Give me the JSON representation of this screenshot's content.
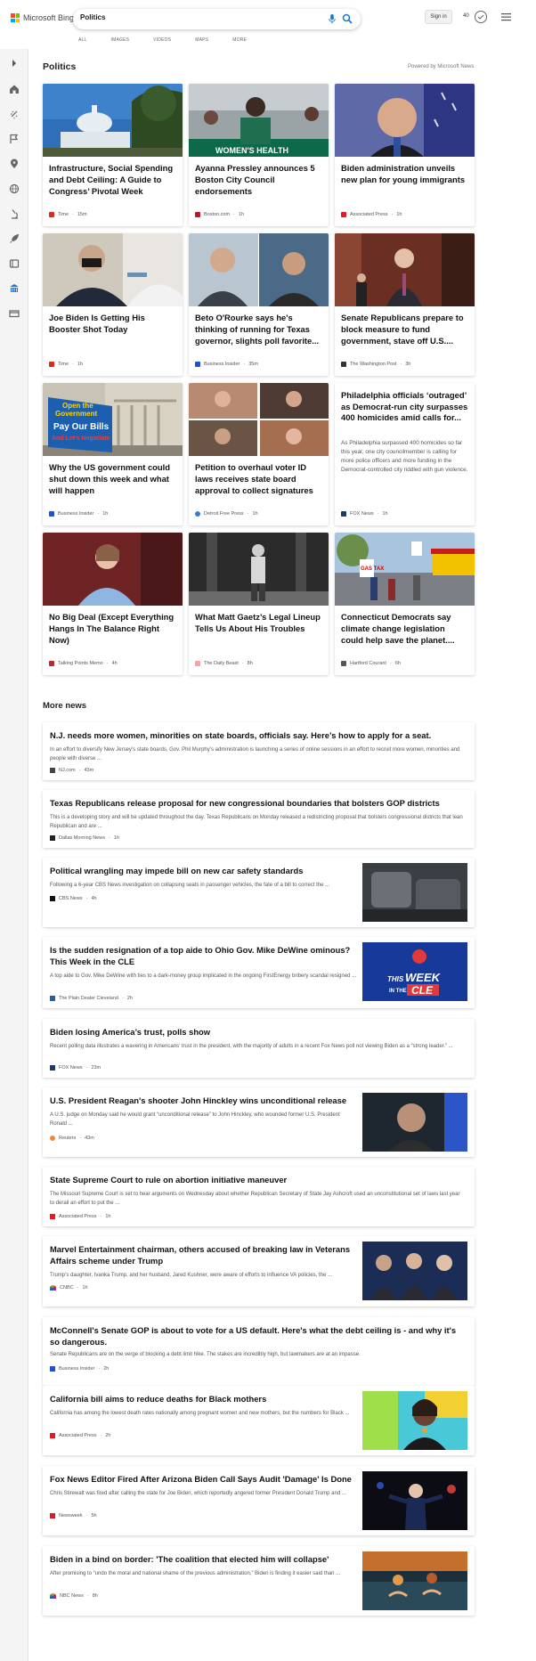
{
  "header": {
    "brand": "Microsoft Bing",
    "search_value": "Politics",
    "signin_label": "Sign in",
    "rewards_count": "40",
    "tabs": [
      "ALL",
      "IMAGES",
      "VIDEOS",
      "MAPS",
      "MORE"
    ]
  },
  "section": {
    "title": "Politics",
    "powered_by": "Powered by Microsoft News"
  },
  "cards": [
    {
      "title": "Infrastructure, Social Spending and Debt Ceiling: A Guide to Congress’ Pivotal Week",
      "source": "Time",
      "time": "15m",
      "fav": "#d82c20"
    },
    {
      "title": "Ayanna Pressley announces 5 Boston City Council endorsements",
      "source": "Boston.com",
      "time": "1h",
      "fav": "#c8102e",
      "image_caption": "WOMEN'S HEALTH"
    },
    {
      "title": "Biden administration unveils new plan for young immigrants",
      "source": "Associated Press",
      "time": "1h",
      "fav": "#e31b23"
    },
    {
      "title": "Joe Biden Is Getting His Booster Shot Today",
      "source": "Time",
      "time": "1h",
      "fav": "#d82c20"
    },
    {
      "title": "Beto O'Rourke says he's thinking of running for Texas governor, slights poll favorite...",
      "source": "Business Insider",
      "time": "35m",
      "fav": "#1a53d8"
    },
    {
      "title": "Senate Republicans prepare to block measure to fund government, stave off U.S....",
      "source": "The Washington Post",
      "time": "3h",
      "fav": "#333333"
    },
    {
      "title": "Why the US government could shut down this week and what will happen",
      "source": "Business Insider",
      "time": "1h",
      "fav": "#1a53d8",
      "sign_lines": [
        "Open the",
        "Government",
        "Pay Our Bills",
        "And Let's Negotiate"
      ]
    },
    {
      "title": "Petition to overhaul voter ID laws receives state board approval to collect signatures",
      "source": "Detroit Free Press",
      "time": "1h",
      "fav": "#3a7bd5"
    },
    {
      "title": "Philadelphia officials ‘outraged’ as Democrat-run city surpasses 400 homicides amid calls for...",
      "description": "As Philadelphia surpassed 400 homicides so far this year, one city councilmember is calling for more police officers and more funding in the Democrat-controlled city riddled with gun violence.",
      "source": "FOX News",
      "time": "1h",
      "fav": "#1b3a6b"
    },
    {
      "title": "No Big Deal (Except Everything Hangs In The Balance Right Now)",
      "source": "Talking Points Memo",
      "time": "4h",
      "fav": "#c0262d"
    },
    {
      "title": "What Matt Gaetz’s Legal Lineup Tells Us About His Troubles",
      "source": "The Daily Beast",
      "time": "8h",
      "fav": "#f5a3a3"
    },
    {
      "title": "Connecticut Democrats say climate change legislation could help save the planet....",
      "source": "Hartford Courant",
      "time": "6h",
      "fav": "#555555",
      "sign_text": "GAS TAX"
    }
  ],
  "more_news": {
    "title": "More news",
    "items": [
      {
        "title": "N.J. needs more women, minorities on state boards, officials say. Here’s how to apply for a seat.",
        "description": "In an effort to diversify New Jersey’s state boards, Gov. Phil Murphy’s administration is launching a series of online sessions in an effort to recruit more women, minorities and people with diverse ...",
        "source": "NJ.com",
        "time": "43m",
        "fav": "#444444"
      },
      {
        "title": "Texas Republicans release proposal for new congressional boundaries that bolsters GOP districts",
        "description": "This is a developing story and will be updated throughout the day. Texas Republicans on Monday released a redistricting proposal that bolsters congressional districts that lean Republican and are ...",
        "source": "Dallas Morning News",
        "time": "1h",
        "fav": "#222222"
      },
      {
        "title": "Political wrangling may impede bill on new car safety standards",
        "description": "Following a 6-year CBS News investigation on collapsing seats in passenger vehicles, the fate of a bill to correct the ...",
        "source": "CBS News",
        "time": "4h",
        "fav": "#111111"
      },
      {
        "title": "Is the sudden resignation of a top aide to Ohio Gov. Mike DeWine ominous? This Week in the CLE",
        "description": "A top aide to Gov. Mike DeWine with ties to a dark-money group implicated in the ongoing FirstEnergy bribery scandal resigned ...",
        "source": "The Plain Dealer Cleveland",
        "time": "2h",
        "fav": "#2b5c9c",
        "image_text": [
          "THIS",
          "WEEK",
          "IN THE",
          "CLE"
        ]
      },
      {
        "title": "Biden losing America’s trust, polls show",
        "description": "Recent polling data illustrates a wavering in Americans’ trust in the president, with the majority of adults in a recent Fox News poll not viewing Biden as a “strong leader.” ...",
        "source": "FOX News",
        "time": "23m",
        "fav": "#1b3a6b"
      },
      {
        "title": "U.S. President Reagan's shooter John Hinckley wins unconditional release",
        "description": "A U.S. judge on Monday said he would grant “unconditional release” to John Hinckley, who wounded former U.S. President Ronald ...",
        "source": "Reuters",
        "time": "43m",
        "fav": "#f28b30"
      },
      {
        "title": "State Supreme Court to rule on abortion initiative maneuver",
        "description": "The Missouri Supreme Court is set to hear arguments on Wednesday about whether Republican Secretary of State Jay Ashcroft used an unconstitutional set of laws last year to derail an effort to put the ...",
        "source": "Associated Press",
        "time": "1h",
        "fav": "#e31b23"
      },
      {
        "title": "Marvel Entertainment chairman, others accused of breaking law in Veterans Affairs scheme under Trump",
        "description": "Trump’s daughter, Ivanka Trump, and her husband, Jared Kushner, were aware of efforts to influence VA policies, the ...",
        "source": "CNBC",
        "time": "1h",
        "fav": "#e6a11b"
      },
      {
        "title": "McConnell's Senate GOP is about to vote for a US default. Here's what the debt ceiling is - and why it's so dangerous.",
        "description": "Senate Republicans are on the verge of blocking a debt limit hike. The stakes are incredibly high, but lawmakers are at an impasse.",
        "source": "Business Insider",
        "time": "2h",
        "fav": "#1a53d8"
      },
      {
        "title": "California bill aims to reduce deaths for Black mothers",
        "description": "California has among the lowest death rates nationally among pregnant women and new mothers, but the numbers for Black ...",
        "source": "Associated Press",
        "time": "2h",
        "fav": "#e31b23"
      },
      {
        "title": "Fox News Editor Fired After Arizona Biden Call Says Audit 'Damage' Is Done",
        "description": "Chris Stirewalt was fired after calling the state for Joe Biden, which reportedly angered former President Donald Trump and ...",
        "source": "Newsweek",
        "time": "5h",
        "fav": "#d11f26"
      },
      {
        "title": "Biden in a bind on border: 'The coalition that elected him will collapse'",
        "description": "After promising to “undo the moral and national shame of the previous administration,” Biden is finding it easier said than ...",
        "source": "NBC News",
        "time": "8h",
        "fav": "#333333"
      }
    ]
  }
}
